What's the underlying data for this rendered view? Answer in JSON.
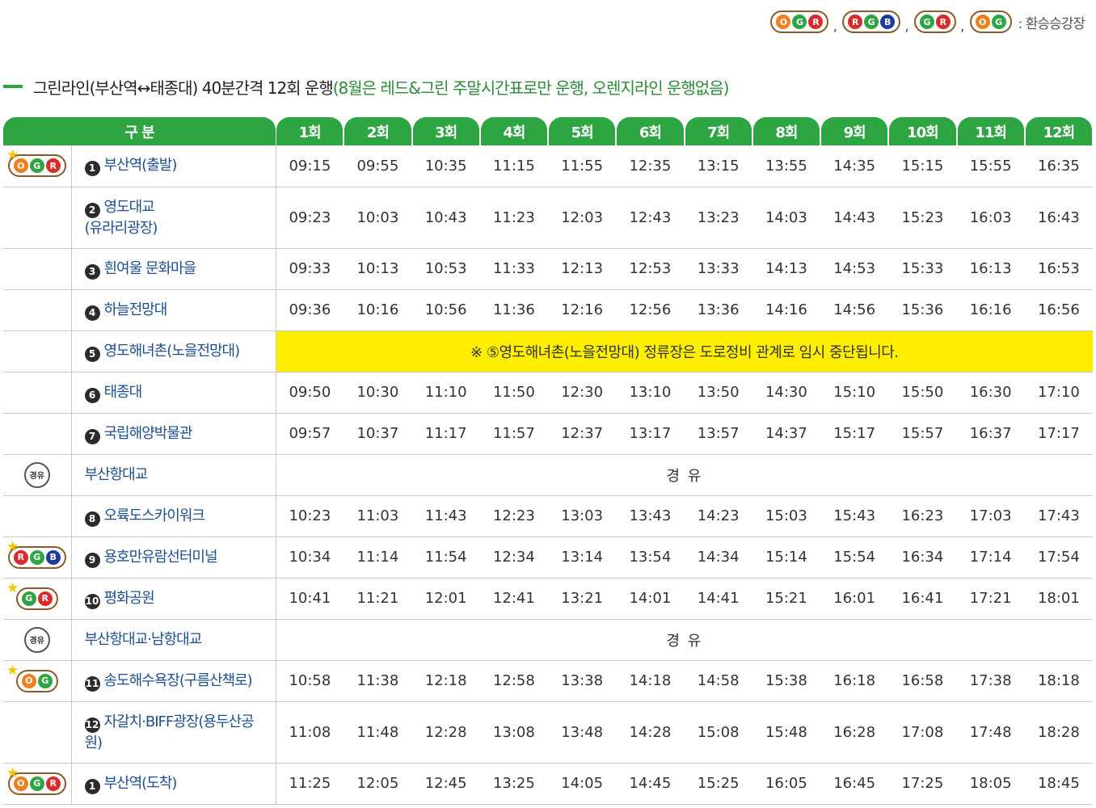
{
  "legend": {
    "badges": [
      [
        "O",
        "G",
        "R"
      ],
      [
        "R",
        "G",
        "B"
      ],
      [
        "G",
        "R"
      ],
      [
        "O",
        "G"
      ]
    ],
    "text": ": 환승승강장"
  },
  "section": {
    "title": "그린라인(부산역↔태종대) 40분간격 12회 운행",
    "note": "(8월은 레드&그린 주말시간표로만 운행, 오렌지라인 운행없음)"
  },
  "table": {
    "stop_header": "구 분",
    "run_headers": [
      "1회",
      "2회",
      "3회",
      "4회",
      "5회",
      "6회",
      "7회",
      "8회",
      "9회",
      "10회",
      "11회",
      "12회"
    ],
    "rows": [
      {
        "badge": [
          "O",
          "G",
          "R"
        ],
        "star": true,
        "num": "1",
        "name": "부산역(출발)",
        "times": [
          "09:15",
          "09:55",
          "10:35",
          "11:15",
          "11:55",
          "12:35",
          "13:15",
          "13:55",
          "14:35",
          "15:15",
          "15:55",
          "16:35"
        ]
      },
      {
        "num": "2",
        "name": "영도대교",
        "name2": "(유라리광장)",
        "times": [
          "09:23",
          "10:03",
          "10:43",
          "11:23",
          "12:03",
          "12:43",
          "13:23",
          "14:03",
          "14:43",
          "15:23",
          "16:03",
          "16:43"
        ]
      },
      {
        "num": "3",
        "name": "흰여울 문화마을",
        "times": [
          "09:33",
          "10:13",
          "10:53",
          "11:33",
          "12:13",
          "12:53",
          "13:33",
          "14:13",
          "14:53",
          "15:33",
          "16:13",
          "16:53"
        ]
      },
      {
        "num": "4",
        "name": "하늘전망대",
        "times": [
          "09:36",
          "10:16",
          "10:56",
          "11:36",
          "12:16",
          "12:56",
          "13:36",
          "14:16",
          "14:56",
          "15:36",
          "16:16",
          "16:56"
        ]
      },
      {
        "num": "5",
        "name": "영도해녀촌(노을전망대)",
        "notice": "※ ⑤영도해녀촌(노을전망대) 정류장은 도로정비 관계로 임시 중단됩니다."
      },
      {
        "num": "6",
        "name": "태종대",
        "times": [
          "09:50",
          "10:30",
          "11:10",
          "11:50",
          "12:30",
          "13:10",
          "13:50",
          "14:30",
          "15:10",
          "15:50",
          "16:30",
          "17:10"
        ]
      },
      {
        "num": "7",
        "name": "국립해양박물관",
        "times": [
          "09:57",
          "10:37",
          "11:17",
          "11:57",
          "12:37",
          "13:17",
          "13:57",
          "14:37",
          "15:17",
          "15:57",
          "16:37",
          "17:17"
        ]
      },
      {
        "via": true,
        "via_mark": "경유",
        "name": "부산항대교",
        "via_text": "경 유"
      },
      {
        "num": "8",
        "name": "오륙도스카이워크",
        "times": [
          "10:23",
          "11:03",
          "11:43",
          "12:23",
          "13:03",
          "13:43",
          "14:23",
          "15:03",
          "15:43",
          "16:23",
          "17:03",
          "17:43"
        ]
      },
      {
        "badge": [
          "R",
          "G",
          "B"
        ],
        "star": true,
        "num": "9",
        "name": "용호만유람선터미널",
        "times": [
          "10:34",
          "11:14",
          "11:54",
          "12:34",
          "13:14",
          "13:54",
          "14:34",
          "15:14",
          "15:54",
          "16:34",
          "17:14",
          "17:54"
        ]
      },
      {
        "badge": [
          "G",
          "R"
        ],
        "star": true,
        "num": "10",
        "name": "평화공원",
        "times": [
          "10:41",
          "11:21",
          "12:01",
          "12:41",
          "13:21",
          "14:01",
          "14:41",
          "15:21",
          "16:01",
          "16:41",
          "17:21",
          "18:01"
        ]
      },
      {
        "via": true,
        "via_mark": "경유",
        "name": "부산항대교·남항대교",
        "via_text": "경 유"
      },
      {
        "badge": [
          "O",
          "G"
        ],
        "star": true,
        "num": "11",
        "name": "송도해수욕장(구름산책로)",
        "times": [
          "10:58",
          "11:38",
          "12:18",
          "12:58",
          "13:38",
          "14:18",
          "14:58",
          "15:38",
          "16:18",
          "16:58",
          "17:38",
          "18:18"
        ]
      },
      {
        "num": "12",
        "name": "자갈치·BIFF광장(용두산공",
        "name2": "원)",
        "times": [
          "11:08",
          "11:48",
          "12:28",
          "13:08",
          "13:48",
          "14:28",
          "15:08",
          "15:48",
          "16:28",
          "17:08",
          "17:48",
          "18:28"
        ]
      },
      {
        "badge": [
          "O",
          "G",
          "R"
        ],
        "star": true,
        "num": "1",
        "name": "부산역(도착)",
        "times": [
          "11:25",
          "12:05",
          "12:45",
          "13:25",
          "14:05",
          "14:45",
          "15:25",
          "16:05",
          "16:45",
          "17:25",
          "18:05",
          "18:45"
        ]
      }
    ]
  },
  "colors": {
    "accent": "#2ea543",
    "notice": "#ffee00",
    "stop_text": "#1d4f91",
    "orange": "#f07f1e",
    "green": "#2ea543",
    "red": "#d92b2b",
    "blue": "#1f3c9c"
  }
}
